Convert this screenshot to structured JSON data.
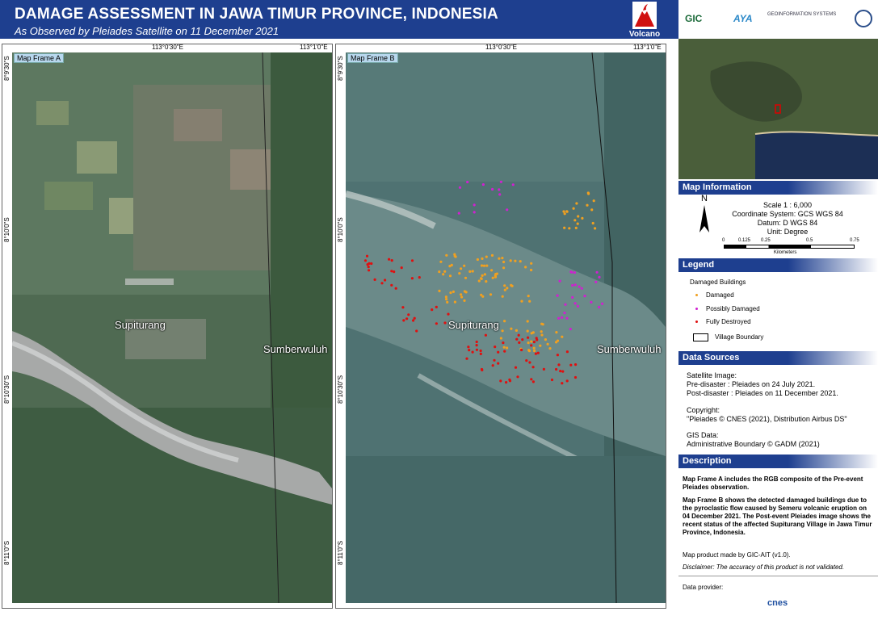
{
  "header": {
    "title": "DAMAGE ASSESSMENT IN JAWA TIMUR PROVINCE, INDONESIA",
    "subtitle": "As Observed by Pleiades Satellite on 11 December 2021",
    "hazard_label": "Volcano"
  },
  "partners": {
    "gic": "GIC",
    "aya": "AYA",
    "geo": "GEOINFORMATION SYSTEMS"
  },
  "frame_a": {
    "label": "Map Frame A",
    "top_lon_1": "113°0'30\"E",
    "top_lon_2": "113°1'0\"E",
    "lat_1": "8°9'30\"S",
    "lat_2": "8°10'0\"S",
    "lat_3": "8°10'30\"S",
    "lat_4": "8°11'0\"S",
    "place_1": "Supiturang",
    "place_2": "Sumberwuluh"
  },
  "frame_b": {
    "label": "Map Frame B",
    "top_lon_1": "113°0'30\"E",
    "top_lon_2": "113°1'0\"E",
    "lat_1": "8°9'30\"S",
    "lat_2": "8°10'0\"S",
    "lat_3": "8°10'30\"S",
    "lat_4": "8°11'0\"S",
    "place_1": "Supiturang",
    "place_2": "Sumberwuluh"
  },
  "map_information": {
    "heading": "Map Information",
    "north": "N",
    "scale": "Scale 1 : 6,000",
    "coord_system": "Coordinate System: GCS WGS 84",
    "datum": "Datum: D WGS 84",
    "unit": "Unit: Degree",
    "scalebar_ticks": [
      "0",
      "0.125",
      "0.25",
      "0.5",
      "0.75"
    ],
    "scalebar_unit": "Kilometers"
  },
  "legend": {
    "heading": "Legend",
    "group": "Damaged Buildings",
    "items": [
      {
        "label": "Damaged",
        "color": "#f0a020"
      },
      {
        "label": "Possibly Damaged",
        "color": "#d020d0"
      },
      {
        "label": "Fully Destroyed",
        "color": "#e01010"
      },
      {
        "label": "Village Boundary",
        "color": "#000000"
      }
    ]
  },
  "data_sources": {
    "heading": "Data Sources",
    "l1": "Satellite Image:",
    "l2": "Pre-disaster   : Pleiades on 24 July 2021.",
    "l3": "Post-disaster : Pleiades on 11 December 2021.",
    "l4": "Copyright:",
    "l5": "\"Pleiades © CNES (2021), Distribution Airbus DS\"",
    "l6": "GIS Data:",
    "l7": "Administrative Boundary © GADM (2021)"
  },
  "description": {
    "heading": "Description",
    "p1": "Map Frame A includes the RGB composite of the Pre-event Pleiades observation.",
    "p2": "Map Frame B shows the detected damaged buildings due to the pyroclastic flow caused by Semeru volcanic eruption on 04 December 2021. The Post-event Pleiades image shows the recent status of the affected Supiturang Village in Jawa Timur Province, Indonesia.",
    "p3": "Map product made by GIC-AIT (v1.0).",
    "p4": "Disclaimer: The accuracy of this product is not validated.",
    "p5": "Data provider:",
    "provider": "cnes"
  }
}
